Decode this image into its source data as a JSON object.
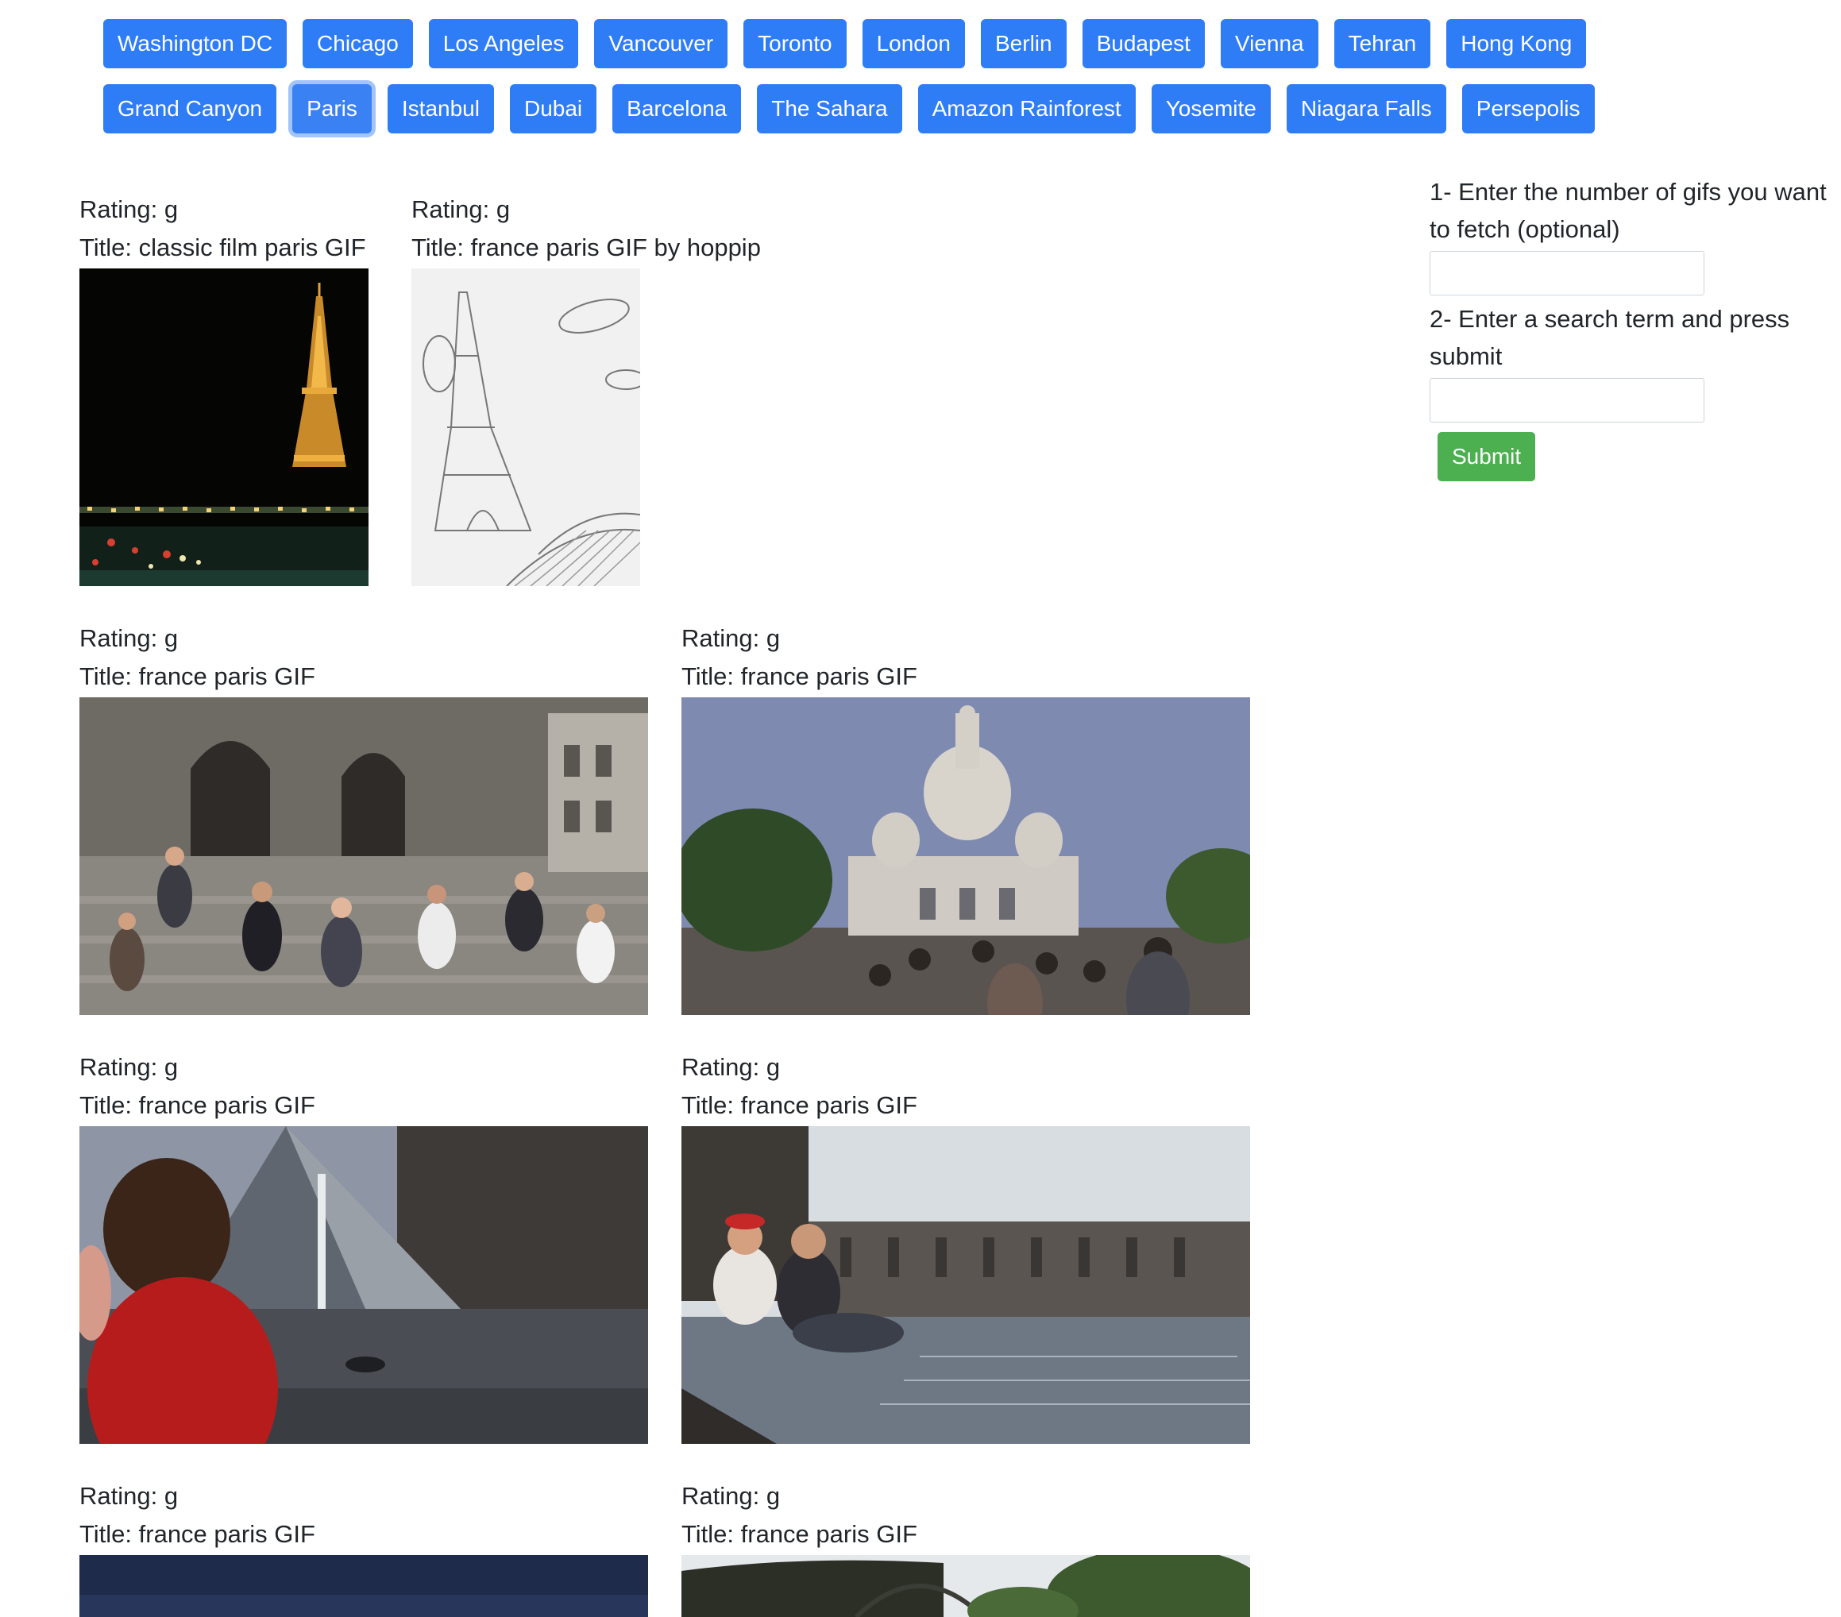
{
  "topics_row1": [
    "Washington DC",
    "Chicago",
    "Los Angeles",
    "Vancouver",
    "Toronto",
    "London",
    "Berlin",
    "Budapest",
    "Vienna",
    "Tehran",
    "Hong Kong"
  ],
  "topics_row2": [
    "Grand Canyon",
    "Paris",
    "Istanbul",
    "Dubai",
    "Barcelona",
    "The Sahara",
    "Amazon Rainforest",
    "Yosemite",
    "Niagara Falls",
    "Persepolis"
  ],
  "active_topic": "Paris",
  "colors": {
    "button_blue": "#2e7cf6",
    "submit_green": "#4caf50"
  },
  "gifs": [
    {
      "rating": "Rating: g",
      "title": "Title: classic film paris GIF"
    },
    {
      "rating": "Rating: g",
      "title": "Title: france paris GIF by hoppip"
    },
    {
      "rating": "Rating: g",
      "title": "Title: france paris GIF"
    },
    {
      "rating": "Rating: g",
      "title": "Title: france paris GIF"
    },
    {
      "rating": "Rating: g",
      "title": "Title: france paris GIF"
    },
    {
      "rating": "Rating: g",
      "title": "Title: france paris GIF"
    },
    {
      "rating": "Rating: g",
      "title": "Title: france paris GIF"
    },
    {
      "rating": "Rating: g",
      "title": "Title: france paris GIF"
    }
  ],
  "form": {
    "step1_label": "1- Enter the number of gifs you want to fetch (optional)",
    "count_value": "",
    "step2_label": "2- Enter a search term and press submit",
    "term_value": "",
    "submit_label": "Submit"
  }
}
